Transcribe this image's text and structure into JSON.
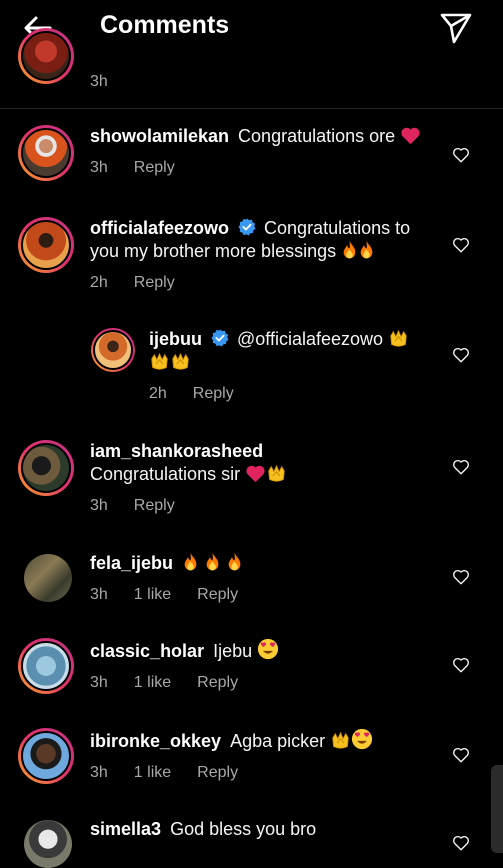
{
  "header": {
    "title": "Comments"
  },
  "partial": {
    "time": "3h"
  },
  "comments": [
    {
      "username": "showolamilekan",
      "verified": false,
      "text": "Congratulations ore",
      "time": "3h",
      "likes": "",
      "reply": "Reply"
    },
    {
      "username": "officialafeezowo",
      "verified": true,
      "text": "Congratulations to you my brother more blessings",
      "time": "2h",
      "likes": "",
      "reply": "Reply"
    },
    {
      "username": "ijebuu",
      "verified": true,
      "text": "@officialafeezowo",
      "time": "2h",
      "likes": "",
      "reply": "Reply"
    },
    {
      "username": "iam_shankorasheed",
      "verified": false,
      "text": "Congratulations sir",
      "time": "3h",
      "likes": "",
      "reply": "Reply"
    },
    {
      "username": "fela_ijebu",
      "verified": false,
      "text": "",
      "time": "3h",
      "likes": "1 like",
      "reply": "Reply"
    },
    {
      "username": "classic_holar",
      "verified": false,
      "text": "Ijebu",
      "time": "3h",
      "likes": "1 like",
      "reply": "Reply"
    },
    {
      "username": "ibironke_okkey",
      "verified": false,
      "text": "Agba picker",
      "time": "3h",
      "likes": "1 like",
      "reply": "Reply"
    },
    {
      "username": "simella3",
      "verified": false,
      "text": "God bless you bro",
      "time": "",
      "likes": "",
      "reply": ""
    }
  ],
  "colors": {
    "background": "#000000",
    "secondary_text": "#a8a8a8",
    "verified_blue": "#3897f0",
    "heart_red": "#e0245e"
  },
  "icons": [
    "back-arrow-icon",
    "send-icon",
    "heart-outline-icon",
    "verified-icon",
    "fire-emoji",
    "clap-emoji",
    "red-heart-emoji",
    "heart-eyes-emoji"
  ]
}
